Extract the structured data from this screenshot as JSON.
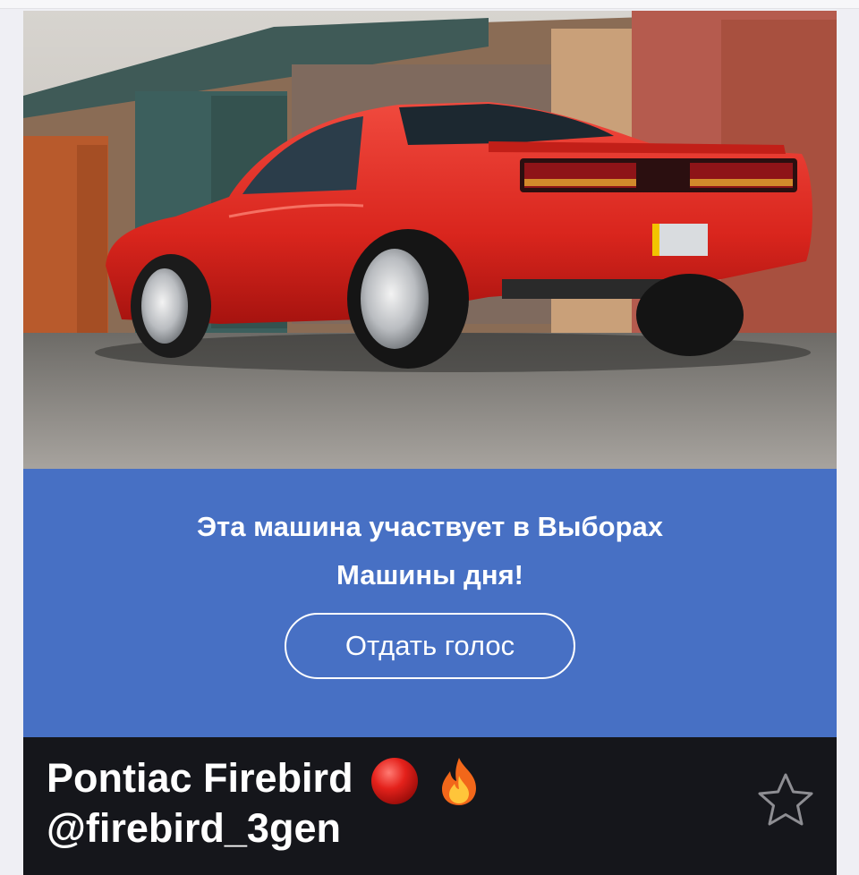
{
  "post": {
    "photo_alt": "Pontiac Firebird",
    "promo": {
      "line1": "Эта машина участвует в Выборах",
      "line2": "Машины дня!",
      "button_label": "Отдать голос"
    },
    "title": "Pontiac Firebird",
    "handle": "@firebird_3gen",
    "title_icons": [
      "red-circle-icon",
      "fire-icon"
    ],
    "favorite_icon": "star-outline-icon"
  },
  "colors": {
    "promo_bg": "#4770c4",
    "title_bg": "#15161b",
    "car_red": "#e02828"
  }
}
